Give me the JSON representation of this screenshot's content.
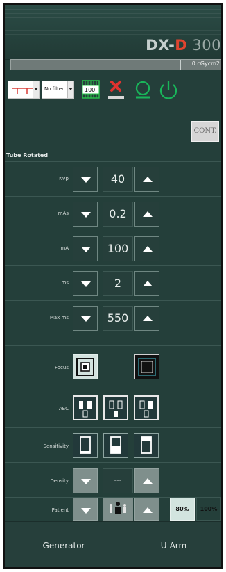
{
  "app": {
    "brand_prefix": "DX-",
    "brand_letter": "D",
    "brand_suffix": " 300"
  },
  "dose": {
    "value": "0 cGycm2"
  },
  "toolbar": {
    "collimator_icon": "collimator-shape-icon",
    "filter_value": "No filter",
    "grid_value": "100",
    "icons": [
      "delete-icon",
      "exposure-indicator-icon",
      "power-icon"
    ]
  },
  "cont_button": {
    "label": "CONT."
  },
  "section": {
    "title": "Tube Rotated"
  },
  "parameters": [
    {
      "label": "KVp",
      "value": "40"
    },
    {
      "label": "mAs",
      "value": "0.2"
    },
    {
      "label": "mA",
      "value": "100"
    },
    {
      "label": "ms",
      "value": "2"
    },
    {
      "label": "Max ms",
      "value": "550"
    }
  ],
  "focus": {
    "label": "Focus",
    "selected": "small-focus"
  },
  "aec": {
    "label": "AEC",
    "chambers": [
      "left-right-chambers",
      "center-chamber",
      "right-chamber"
    ]
  },
  "sensitivity": {
    "label": "Sensitivity",
    "levels": [
      "low",
      "medium",
      "high"
    ]
  },
  "density": {
    "label": "Density",
    "value": "---"
  },
  "patient": {
    "label": "Patient",
    "percent_options": [
      "80%",
      "100%"
    ],
    "selected_percent": "80%"
  },
  "footer": {
    "tabs": [
      "Generator",
      "U-Arm"
    ]
  },
  "colors": {
    "panel_bg": "#243f3a",
    "brand_red": "#e0442f",
    "icon_red": "#e0332f",
    "icon_green": "#19b55a",
    "disabled_button": "#7f8f8c"
  }
}
